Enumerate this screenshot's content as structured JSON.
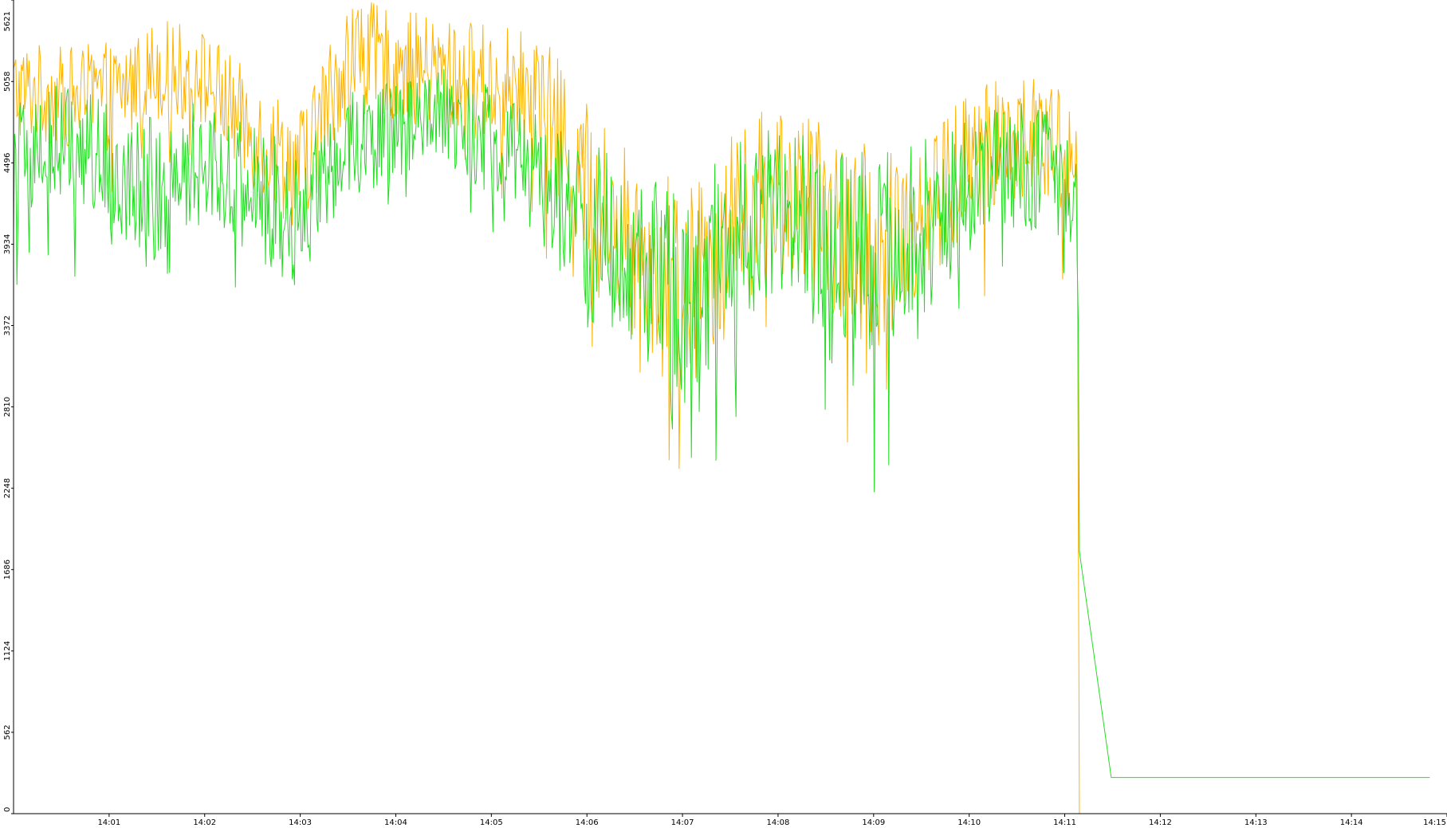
{
  "chart_data": {
    "type": "line",
    "title": "",
    "xlabel": "",
    "ylabel": "",
    "grid": false,
    "legend": "none",
    "xlim": [
      "14:00:00",
      "14:15:00"
    ],
    "ylim": [
      0,
      5621
    ],
    "y_ticks": [
      0,
      562,
      1124,
      1686,
      2248,
      2810,
      3372,
      3934,
      4496,
      5058,
      5621
    ],
    "x_ticks": [
      "14:01",
      "14:02",
      "14:03",
      "14:04",
      "14:05",
      "14:06",
      "14:07",
      "14:08",
      "14:09",
      "14:10",
      "14:11",
      "14:12",
      "14:13",
      "14:14",
      "14:15"
    ],
    "colors": {
      "axis": "#000000",
      "background": "#ffffff"
    },
    "series": [
      {
        "color": "#ffb300",
        "times": [
          "14:00:00",
          "14:00:30",
          "14:01:00",
          "14:01:30",
          "14:02:00",
          "14:02:30",
          "14:03:00",
          "14:03:30",
          "14:04:00",
          "14:04:30",
          "14:05:00",
          "14:05:30",
          "14:06:00",
          "14:06:30",
          "14:07:00",
          "14:07:30",
          "14:08:00",
          "14:08:30",
          "14:09:00",
          "14:09:30",
          "14:10:00",
          "14:10:30",
          "14:11:00",
          "14:11:08",
          "14:11:09",
          "14:15:00"
        ],
        "base": [
          5000,
          4950,
          4950,
          5150,
          5080,
          4700,
          4450,
          5250,
          5180,
          5100,
          5050,
          4950,
          4300,
          3950,
          3600,
          4050,
          4350,
          4100,
          3900,
          4150,
          4500,
          4700,
          4550,
          4400,
          0,
          0
        ],
        "amplitude": [
          350,
          350,
          380,
          350,
          350,
          400,
          450,
          400,
          380,
          400,
          420,
          450,
          650,
          650,
          750,
          650,
          600,
          650,
          700,
          650,
          500,
          450,
          450,
          350,
          0,
          0
        ]
      },
      {
        "color": "#22dd22",
        "times": [
          "14:00:00",
          "14:00:30",
          "14:01:00",
          "14:01:30",
          "14:02:00",
          "14:02:30",
          "14:03:00",
          "14:03:30",
          "14:04:00",
          "14:04:30",
          "14:05:00",
          "14:05:30",
          "14:06:00",
          "14:06:30",
          "14:07:00",
          "14:07:30",
          "14:08:00",
          "14:08:30",
          "14:09:00",
          "14:09:30",
          "14:10:00",
          "14:10:30",
          "14:11:00",
          "14:11:08",
          "14:11:09",
          "14:11:10",
          "14:15:00"
        ],
        "base": [
          4450,
          4650,
          4500,
          4300,
          4550,
          4300,
          4100,
          4650,
          4700,
          4800,
          4650,
          4400,
          4050,
          3800,
          3550,
          3950,
          4200,
          3950,
          3900,
          4050,
          4350,
          4500,
          4400,
          4300,
          2200,
          250,
          250
        ],
        "amplitude": [
          450,
          400,
          450,
          500,
          420,
          450,
          500,
          380,
          350,
          350,
          380,
          450,
          650,
          650,
          750,
          650,
          600,
          650,
          700,
          650,
          500,
          450,
          450,
          350,
          0,
          0,
          0
        ]
      }
    ]
  }
}
